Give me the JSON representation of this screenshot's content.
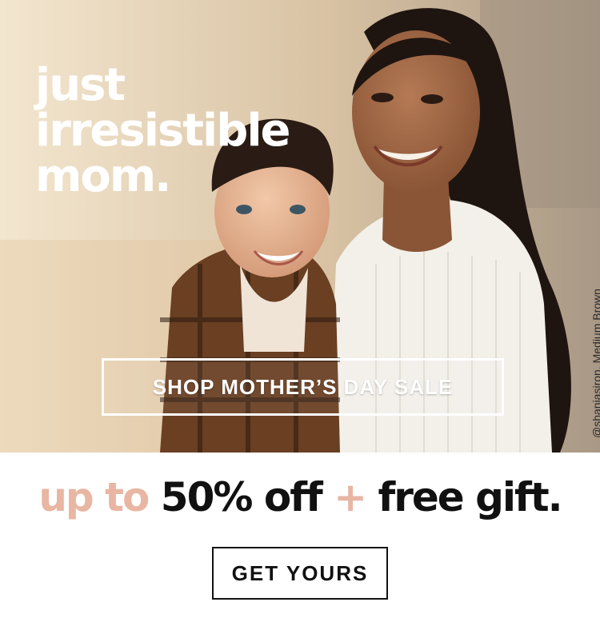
{
  "hero": {
    "headline": [
      "just",
      "irresistible",
      "mom."
    ],
    "photo_credit": "@shaniasiron, Medium Brown",
    "photo_description": "mother-and-son-photo"
  },
  "cta_primary": {
    "label": "SHOP MOTHER’S DAY SALE"
  },
  "offer": {
    "part1": "up to ",
    "part2": "50% off",
    "part3": " + ",
    "part4": "free gift."
  },
  "cta_secondary": {
    "label": "GET YOURS"
  },
  "colors": {
    "accent": "#e8b6a2",
    "text": "#111111",
    "background": "#ffffff"
  }
}
